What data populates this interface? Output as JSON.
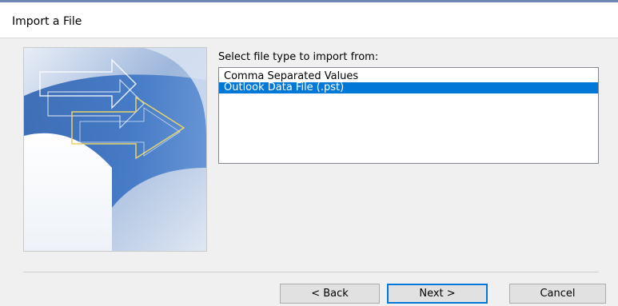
{
  "dialog": {
    "title": "Import a File"
  },
  "main": {
    "prompt": "Select file type to import from:",
    "file_types": [
      {
        "label": "Comma Separated Values",
        "selected": false
      },
      {
        "label": "Outlook Data File (.pst)",
        "selected": true
      }
    ]
  },
  "buttons": {
    "back_label": "< Back",
    "next_label": "Next >",
    "cancel_label": "Cancel"
  },
  "colors": {
    "selection": "#0078d7",
    "arrow_outline": "#e6d46a"
  }
}
